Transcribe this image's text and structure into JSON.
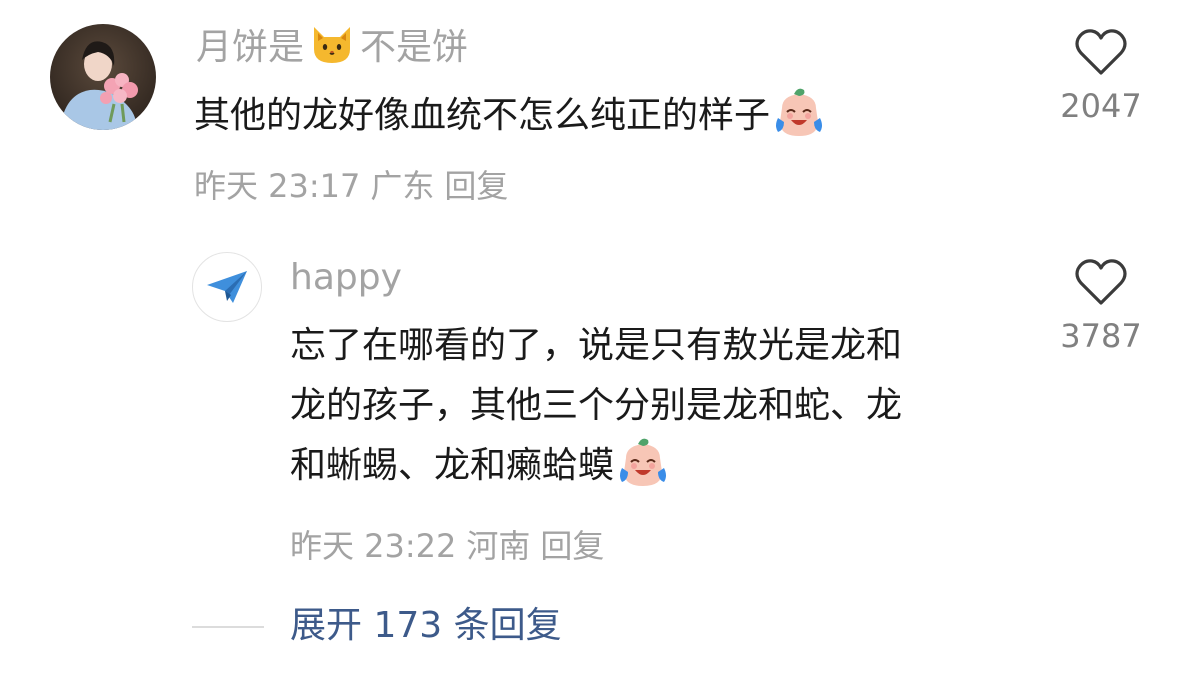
{
  "comment": {
    "username_part1": "月饼是",
    "username_part2": "不是饼",
    "text": "其他的龙好像血统不怎么纯正的样子",
    "time": "昨天 23:17",
    "location": "广东",
    "reply_label": "回复",
    "like_count": "2047",
    "avatar_icon": "user-photo-avatar"
  },
  "reply": {
    "username": "happy",
    "lines": [
      "忘了在哪看的了，说是只有敖光是龙和",
      "龙的孩子，其他三个分别是龙和蛇、龙",
      "和蜥蜴、龙和癞蛤蟆"
    ],
    "time": "昨天 23:22",
    "location": "河南",
    "reply_label": "回复",
    "like_count": "3787",
    "avatar_icon": "paper-plane-icon"
  },
  "expand": {
    "label": "展开 173 条回复"
  },
  "colors": {
    "muted": "#a3a3a3",
    "link": "#3d5a8a",
    "text": "#1a1a1a"
  }
}
